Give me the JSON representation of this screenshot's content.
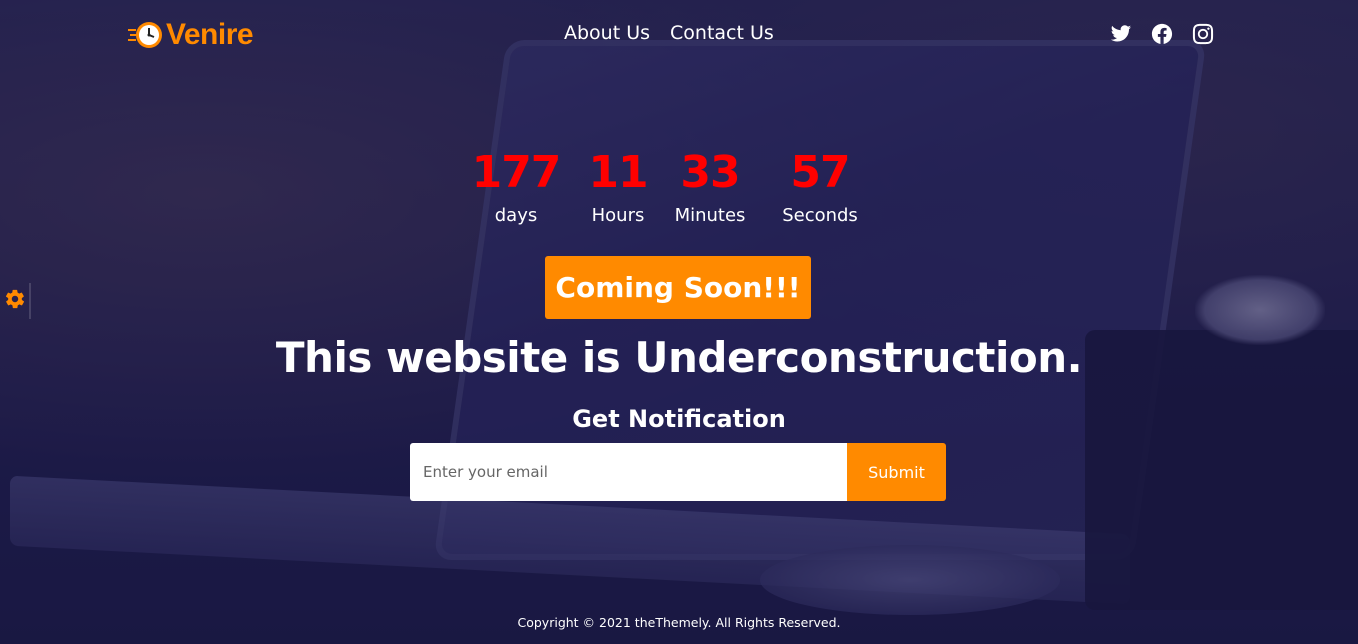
{
  "brand": {
    "name": "Venire",
    "icon": "clock-icon",
    "color": "#ff8a00"
  },
  "nav": [
    {
      "label": "About Us"
    },
    {
      "label": "Contact Us"
    }
  ],
  "social": [
    {
      "icon": "twitter-icon"
    },
    {
      "icon": "facebook-icon"
    },
    {
      "icon": "instagram-icon"
    }
  ],
  "countdown": {
    "days": {
      "value": "177",
      "label": "days"
    },
    "hours": {
      "value": "11",
      "label": "Hours"
    },
    "minutes": {
      "value": "33",
      "label": "Minutes"
    },
    "seconds": {
      "value": "57",
      "label": "Seconds"
    },
    "number_color": "#ff0000"
  },
  "coming_soon": "Coming Soon!!!",
  "headline": "This website is Underconstruction.",
  "notification": {
    "title": "Get Notification",
    "email_placeholder": "Enter your email",
    "submit_label": "Submit"
  },
  "footer": {
    "copyright": "Copyright © 2021 theThemely. All Rights Reserved."
  },
  "settings_icon": "gear-icon",
  "accent": "#ff8a00"
}
